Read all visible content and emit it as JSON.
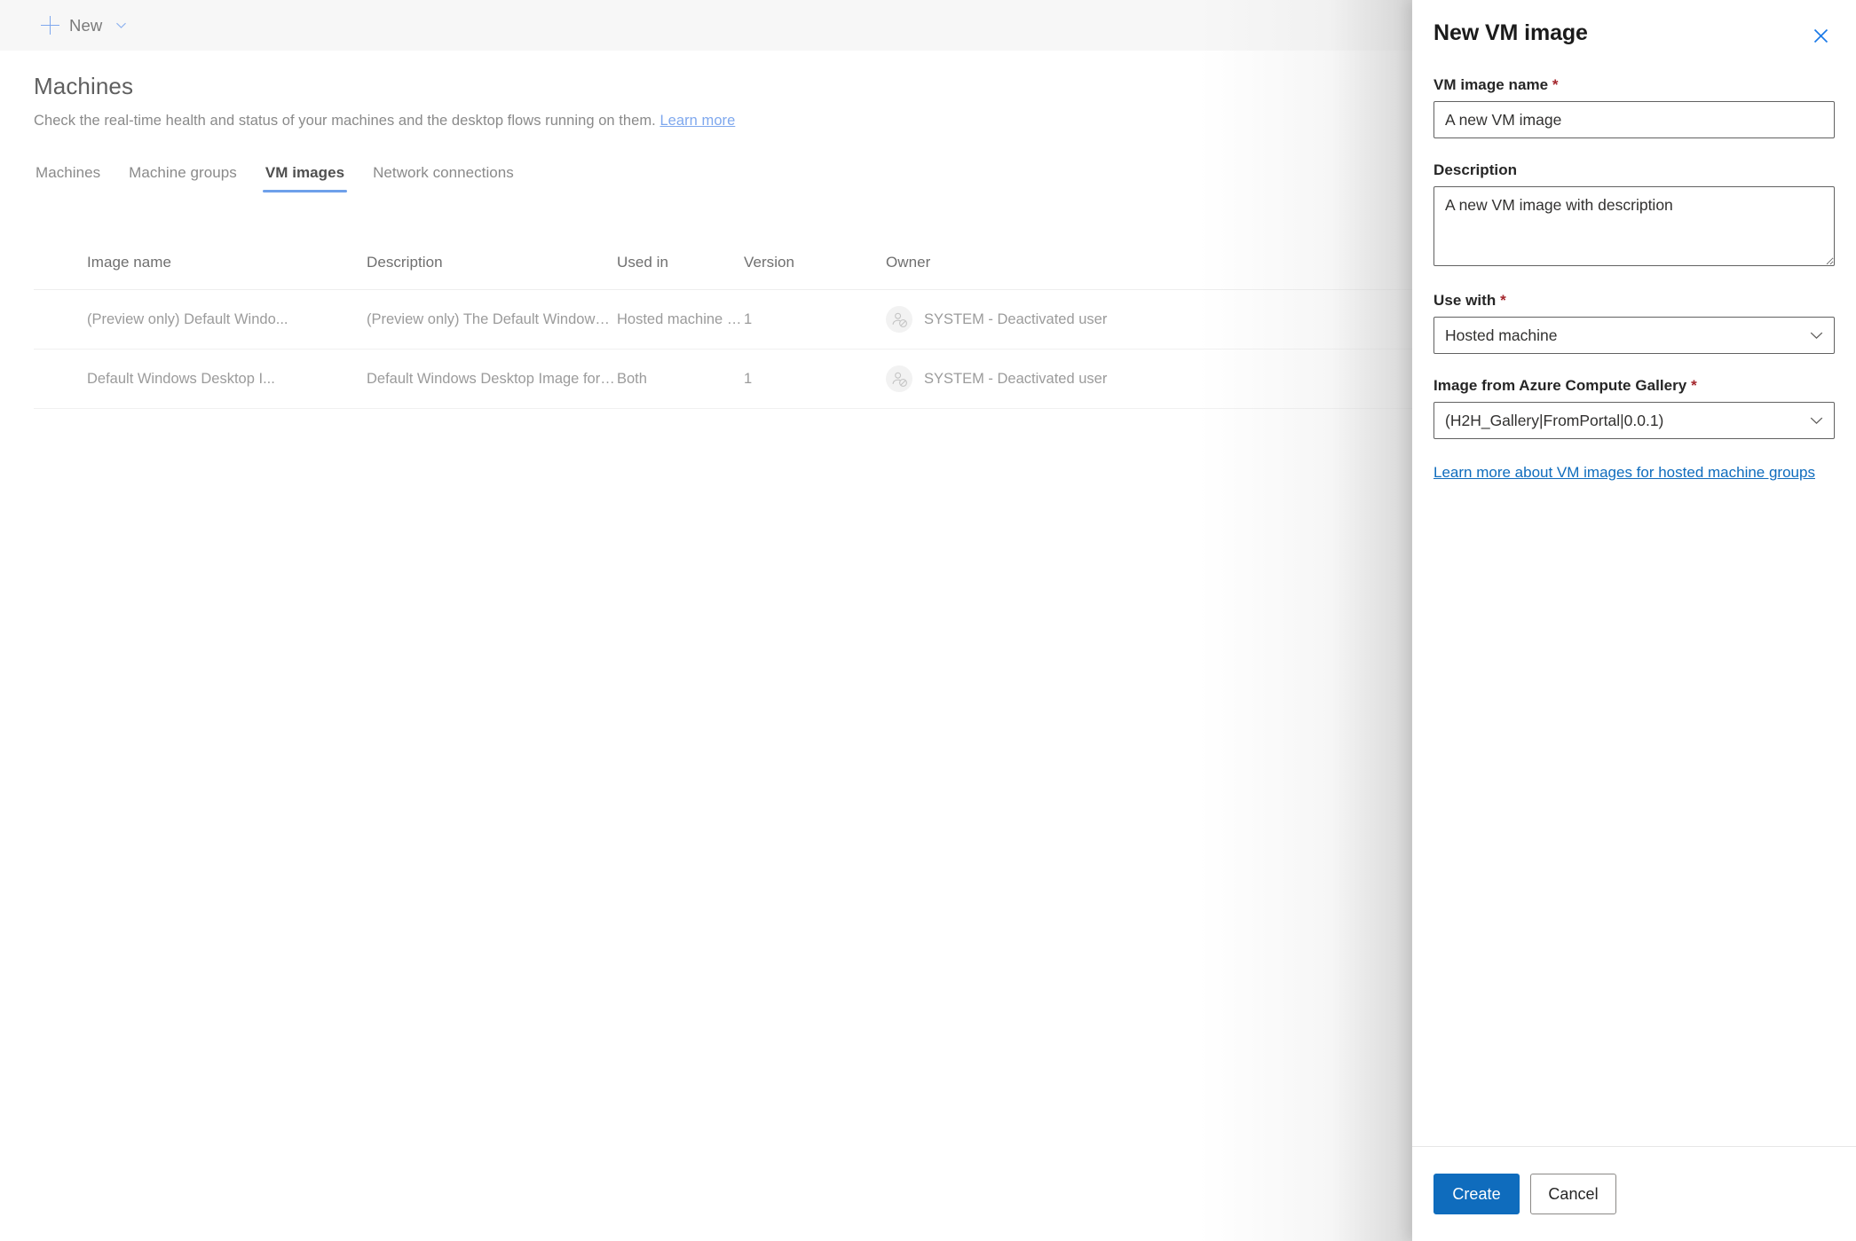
{
  "command_bar": {
    "new_label": "New",
    "plus_icon": "plus-icon",
    "chevron_icon": "chevron-down-icon"
  },
  "page": {
    "title": "Machines",
    "subtitle": "Check the real-time health and status of your machines and the desktop flows running on them.",
    "subtitle_link": "Learn more"
  },
  "tabs": [
    {
      "label": "Machines",
      "active": false
    },
    {
      "label": "Machine groups",
      "active": false
    },
    {
      "label": "VM images",
      "active": true
    },
    {
      "label": "Network connections",
      "active": false
    }
  ],
  "table": {
    "columns": [
      "Image name",
      "Description",
      "Used in",
      "Version",
      "Owner"
    ],
    "rows": [
      {
        "image_name": "(Preview only) Default Windo...",
        "description": "(Preview only) The Default Windows Desk...",
        "used_in": "Hosted machine group",
        "version": "1",
        "owner": "SYSTEM - Deactivated user",
        "owner_icon": "deactivated-user-icon"
      },
      {
        "image_name": "Default Windows Desktop I...",
        "description": "Default Windows Desktop Image for use i...",
        "used_in": "Both",
        "version": "1",
        "owner": "SYSTEM - Deactivated user",
        "owner_icon": "deactivated-user-icon"
      }
    ]
  },
  "panel": {
    "title": "New VM image",
    "close_icon": "close-icon",
    "fields": {
      "vm_image_name": {
        "label": "VM image name",
        "required": "*",
        "value": "A new VM image"
      },
      "description": {
        "label": "Description",
        "value": "A new VM image with description"
      },
      "use_with": {
        "label": "Use with",
        "required": "*",
        "value": "Hosted machine",
        "chevron_icon": "chevron-down-icon"
      },
      "gallery_image": {
        "label": "Image from Azure Compute Gallery",
        "required": "*",
        "value": "(H2H_Gallery|FromPortal|0.0.1)",
        "chevron_icon": "chevron-down-icon"
      }
    },
    "help_link": "Learn more about VM images for hosted machine groups",
    "footer": {
      "create_label": "Create",
      "cancel_label": "Cancel"
    }
  },
  "colors": {
    "accent_blue": "#0f6cbd",
    "link_blue": "#7fa8ee",
    "tab_underline": "#6ea0ea",
    "required_red": "#a4262c",
    "command_bar_bg": "#f7f7f7"
  }
}
